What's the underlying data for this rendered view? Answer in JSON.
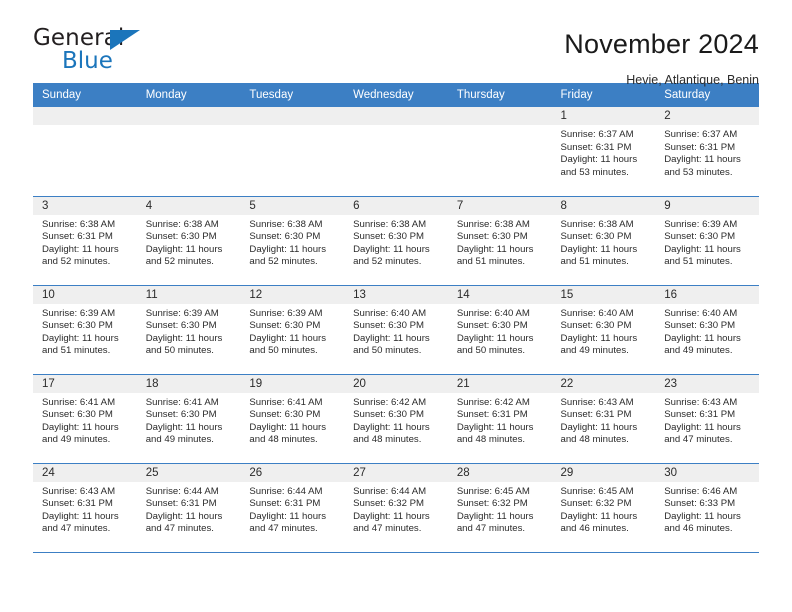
{
  "brand": {
    "word_one": "General",
    "word_two": "Blue",
    "triangle_icon": "triangle-icon"
  },
  "header": {
    "month_title": "November 2024",
    "location": "Hevie, Atlantique, Benin"
  },
  "theme": {
    "header_blue": "#3c7fc4",
    "brand_blue": "#1b75bb",
    "daynum_band": "#efefef",
    "text": "#2b2b2b"
  },
  "weekday_headers": [
    "Sunday",
    "Monday",
    "Tuesday",
    "Wednesday",
    "Thursday",
    "Friday",
    "Saturday"
  ],
  "weeks": [
    [
      {
        "day": "",
        "sunrise": "",
        "sunset": "",
        "daylight": "",
        "empty": true
      },
      {
        "day": "",
        "sunrise": "",
        "sunset": "",
        "daylight": "",
        "empty": true
      },
      {
        "day": "",
        "sunrise": "",
        "sunset": "",
        "daylight": "",
        "empty": true
      },
      {
        "day": "",
        "sunrise": "",
        "sunset": "",
        "daylight": "",
        "empty": true
      },
      {
        "day": "",
        "sunrise": "",
        "sunset": "",
        "daylight": "",
        "empty": true
      },
      {
        "day": "1",
        "sunrise": "Sunrise: 6:37 AM",
        "sunset": "Sunset: 6:31 PM",
        "daylight": "Daylight: 11 hours and 53 minutes.",
        "empty": false
      },
      {
        "day": "2",
        "sunrise": "Sunrise: 6:37 AM",
        "sunset": "Sunset: 6:31 PM",
        "daylight": "Daylight: 11 hours and 53 minutes.",
        "empty": false
      }
    ],
    [
      {
        "day": "3",
        "sunrise": "Sunrise: 6:38 AM",
        "sunset": "Sunset: 6:31 PM",
        "daylight": "Daylight: 11 hours and 52 minutes.",
        "empty": false
      },
      {
        "day": "4",
        "sunrise": "Sunrise: 6:38 AM",
        "sunset": "Sunset: 6:30 PM",
        "daylight": "Daylight: 11 hours and 52 minutes.",
        "empty": false
      },
      {
        "day": "5",
        "sunrise": "Sunrise: 6:38 AM",
        "sunset": "Sunset: 6:30 PM",
        "daylight": "Daylight: 11 hours and 52 minutes.",
        "empty": false
      },
      {
        "day": "6",
        "sunrise": "Sunrise: 6:38 AM",
        "sunset": "Sunset: 6:30 PM",
        "daylight": "Daylight: 11 hours and 52 minutes.",
        "empty": false
      },
      {
        "day": "7",
        "sunrise": "Sunrise: 6:38 AM",
        "sunset": "Sunset: 6:30 PM",
        "daylight": "Daylight: 11 hours and 51 minutes.",
        "empty": false
      },
      {
        "day": "8",
        "sunrise": "Sunrise: 6:38 AM",
        "sunset": "Sunset: 6:30 PM",
        "daylight": "Daylight: 11 hours and 51 minutes.",
        "empty": false
      },
      {
        "day": "9",
        "sunrise": "Sunrise: 6:39 AM",
        "sunset": "Sunset: 6:30 PM",
        "daylight": "Daylight: 11 hours and 51 minutes.",
        "empty": false
      }
    ],
    [
      {
        "day": "10",
        "sunrise": "Sunrise: 6:39 AM",
        "sunset": "Sunset: 6:30 PM",
        "daylight": "Daylight: 11 hours and 51 minutes.",
        "empty": false
      },
      {
        "day": "11",
        "sunrise": "Sunrise: 6:39 AM",
        "sunset": "Sunset: 6:30 PM",
        "daylight": "Daylight: 11 hours and 50 minutes.",
        "empty": false
      },
      {
        "day": "12",
        "sunrise": "Sunrise: 6:39 AM",
        "sunset": "Sunset: 6:30 PM",
        "daylight": "Daylight: 11 hours and 50 minutes.",
        "empty": false
      },
      {
        "day": "13",
        "sunrise": "Sunrise: 6:40 AM",
        "sunset": "Sunset: 6:30 PM",
        "daylight": "Daylight: 11 hours and 50 minutes.",
        "empty": false
      },
      {
        "day": "14",
        "sunrise": "Sunrise: 6:40 AM",
        "sunset": "Sunset: 6:30 PM",
        "daylight": "Daylight: 11 hours and 50 minutes.",
        "empty": false
      },
      {
        "day": "15",
        "sunrise": "Sunrise: 6:40 AM",
        "sunset": "Sunset: 6:30 PM",
        "daylight": "Daylight: 11 hours and 49 minutes.",
        "empty": false
      },
      {
        "day": "16",
        "sunrise": "Sunrise: 6:40 AM",
        "sunset": "Sunset: 6:30 PM",
        "daylight": "Daylight: 11 hours and 49 minutes.",
        "empty": false
      }
    ],
    [
      {
        "day": "17",
        "sunrise": "Sunrise: 6:41 AM",
        "sunset": "Sunset: 6:30 PM",
        "daylight": "Daylight: 11 hours and 49 minutes.",
        "empty": false
      },
      {
        "day": "18",
        "sunrise": "Sunrise: 6:41 AM",
        "sunset": "Sunset: 6:30 PM",
        "daylight": "Daylight: 11 hours and 49 minutes.",
        "empty": false
      },
      {
        "day": "19",
        "sunrise": "Sunrise: 6:41 AM",
        "sunset": "Sunset: 6:30 PM",
        "daylight": "Daylight: 11 hours and 48 minutes.",
        "empty": false
      },
      {
        "day": "20",
        "sunrise": "Sunrise: 6:42 AM",
        "sunset": "Sunset: 6:30 PM",
        "daylight": "Daylight: 11 hours and 48 minutes.",
        "empty": false
      },
      {
        "day": "21",
        "sunrise": "Sunrise: 6:42 AM",
        "sunset": "Sunset: 6:31 PM",
        "daylight": "Daylight: 11 hours and 48 minutes.",
        "empty": false
      },
      {
        "day": "22",
        "sunrise": "Sunrise: 6:43 AM",
        "sunset": "Sunset: 6:31 PM",
        "daylight": "Daylight: 11 hours and 48 minutes.",
        "empty": false
      },
      {
        "day": "23",
        "sunrise": "Sunrise: 6:43 AM",
        "sunset": "Sunset: 6:31 PM",
        "daylight": "Daylight: 11 hours and 47 minutes.",
        "empty": false
      }
    ],
    [
      {
        "day": "24",
        "sunrise": "Sunrise: 6:43 AM",
        "sunset": "Sunset: 6:31 PM",
        "daylight": "Daylight: 11 hours and 47 minutes.",
        "empty": false
      },
      {
        "day": "25",
        "sunrise": "Sunrise: 6:44 AM",
        "sunset": "Sunset: 6:31 PM",
        "daylight": "Daylight: 11 hours and 47 minutes.",
        "empty": false
      },
      {
        "day": "26",
        "sunrise": "Sunrise: 6:44 AM",
        "sunset": "Sunset: 6:31 PM",
        "daylight": "Daylight: 11 hours and 47 minutes.",
        "empty": false
      },
      {
        "day": "27",
        "sunrise": "Sunrise: 6:44 AM",
        "sunset": "Sunset: 6:32 PM",
        "daylight": "Daylight: 11 hours and 47 minutes.",
        "empty": false
      },
      {
        "day": "28",
        "sunrise": "Sunrise: 6:45 AM",
        "sunset": "Sunset: 6:32 PM",
        "daylight": "Daylight: 11 hours and 47 minutes.",
        "empty": false
      },
      {
        "day": "29",
        "sunrise": "Sunrise: 6:45 AM",
        "sunset": "Sunset: 6:32 PM",
        "daylight": "Daylight: 11 hours and 46 minutes.",
        "empty": false
      },
      {
        "day": "30",
        "sunrise": "Sunrise: 6:46 AM",
        "sunset": "Sunset: 6:33 PM",
        "daylight": "Daylight: 11 hours and 46 minutes.",
        "empty": false
      }
    ]
  ]
}
